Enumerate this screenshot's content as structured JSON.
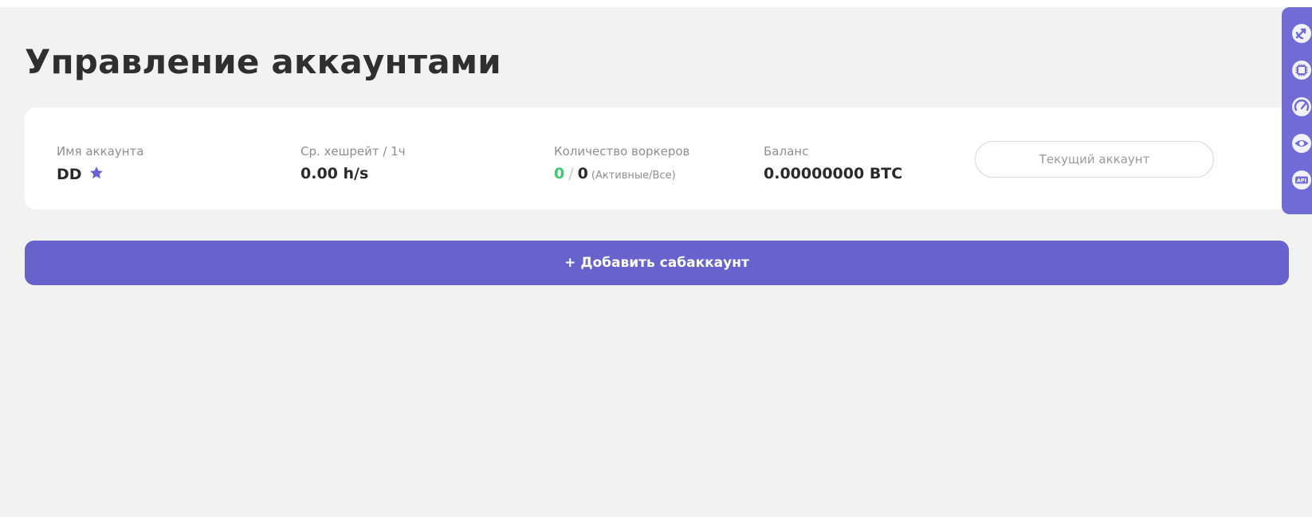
{
  "page": {
    "title": "Управление аккаунтами"
  },
  "account": {
    "name_label": "Имя аккаунта",
    "name_value": "DD",
    "hashrate_label": "Ср. хешрейт / 1ч",
    "hashrate_value": "0.00 h/s",
    "workers_label": "Количество воркеров",
    "workers_active": "0",
    "workers_separator": "/",
    "workers_total": "0",
    "workers_hint": "(Активные/Все)",
    "balance_label": "Баланс",
    "balance_value": "0.00000000 BTC",
    "current_button_label": "Текущий аккаунт"
  },
  "actions": {
    "add_subaccount_label": "+ Добавить сабаккаунт"
  },
  "sidebar": {
    "icons": [
      "pool-icon",
      "chip-icon",
      "speedometer-icon",
      "eye-icon",
      "api-icon"
    ],
    "api_text": "API"
  },
  "colors": {
    "accent": "#6762cc",
    "active_green": "#3bc96b",
    "sidebar": "#716bd5"
  }
}
